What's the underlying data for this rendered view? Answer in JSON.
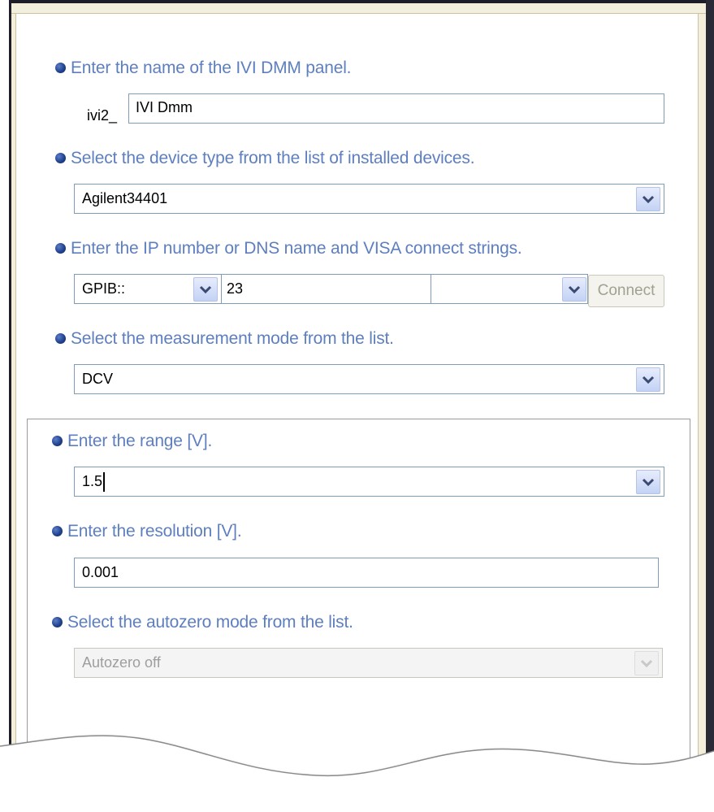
{
  "panel": {
    "name_label": "Enter the name of the IVI DMM panel.",
    "name_prefix": "ivi2_",
    "name_value": "IVI Dmm",
    "device_label": "Select the device type from the list of installed devices.",
    "device_value": "Agilent34401",
    "connect_label": "Enter the IP number or DNS name and VISA connect strings.",
    "interface_value": "GPIB::",
    "address_value": "23",
    "suffix_value": "",
    "connect_button": "Connect",
    "mode_label": "Select the measurement mode from the list.",
    "mode_value": "DCV"
  },
  "settings": {
    "range_label": "Enter the range [V].",
    "range_value": "1.5",
    "resolution_label": "Enter the resolution [V].",
    "resolution_value": "0.001",
    "autozero_label": "Select the autozero mode from the list.",
    "autozero_value": "Autozero off"
  },
  "icons": {
    "bullet": "bullet-icon",
    "dropdown": "chevron-down-icon"
  },
  "colors": {
    "label_text": "#5e7fbf",
    "bullet": "#21438e",
    "frame": "#f3efdb",
    "field_border": "#7f9db9"
  }
}
